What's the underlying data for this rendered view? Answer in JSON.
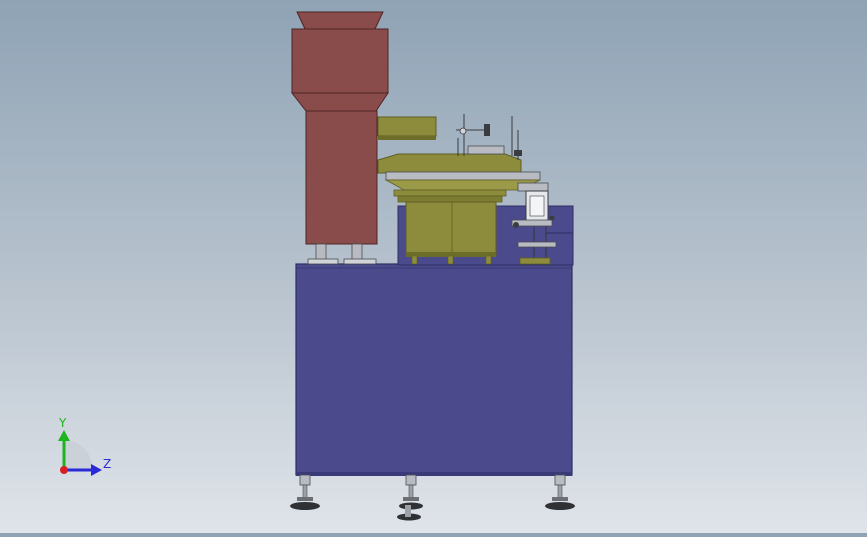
{
  "viewport": {
    "colors": {
      "cabinet": "#4b4a8c",
      "cabinet_edge": "#2f2e63",
      "hopper": "#8a4b4b",
      "hopper_edge": "#4e2424",
      "bowl": "#8c8c3c",
      "bowl_dark": "#5e5e22",
      "metal": "#b8bcc2",
      "metal_dark": "#4a4c50"
    }
  },
  "triad": {
    "y_label": "Y",
    "z_label": "Z",
    "y_color": "#1db41d",
    "z_color": "#2a2ad8",
    "x_color": "#d81e1e"
  }
}
